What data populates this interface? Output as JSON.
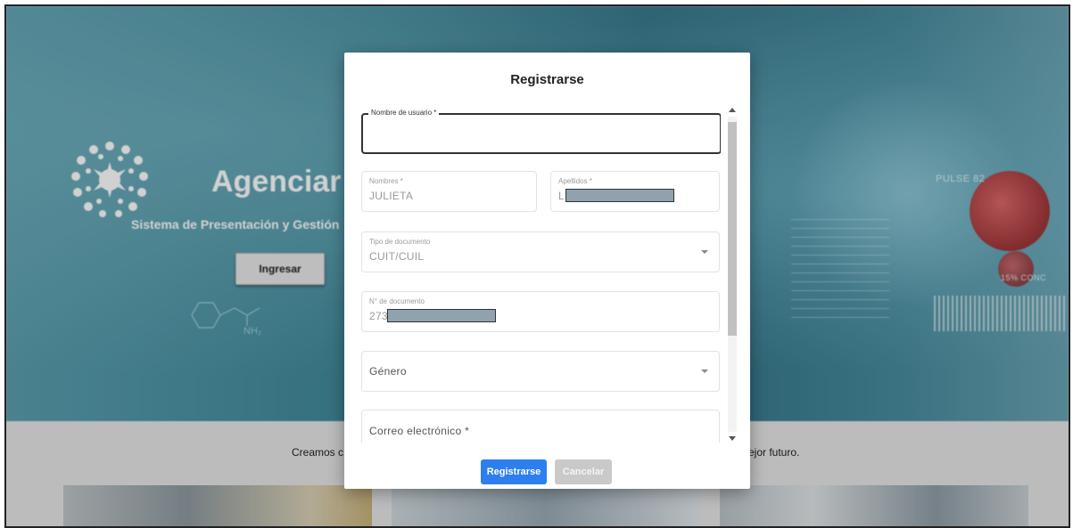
{
  "background": {
    "brand_name": "Agenciar",
    "tagline": "Sistema de Presentación y Gestión",
    "login_button": "Ingresar",
    "molecule_label": "NH₂",
    "hud_pulse": "PULSE 82",
    "hud_conc": "15% CONC",
    "slogan_left": "Creamos c",
    "slogan_right": "ejor futuro."
  },
  "modal": {
    "title": "Registrarse",
    "fields": {
      "username": {
        "label": "Nombre de usuario *",
        "value": ""
      },
      "nombres": {
        "label": "Nombres *",
        "value": "JULIETA"
      },
      "apellidos": {
        "label": "Apellidos *",
        "value": "L"
      },
      "tipo_documento": {
        "label": "Tipo de documento",
        "value": "CUIT/CUIL"
      },
      "nro_documento": {
        "label": "N° de documento",
        "value": "273"
      },
      "genero": {
        "placeholder": "Género"
      },
      "correo": {
        "placeholder": "Correo electrónico *"
      }
    },
    "buttons": {
      "submit": "Registrarse",
      "cancel": "Cancelar"
    }
  },
  "colors": {
    "primary_button": "#2d7ff0",
    "disabled_button": "#c9c9c9"
  }
}
